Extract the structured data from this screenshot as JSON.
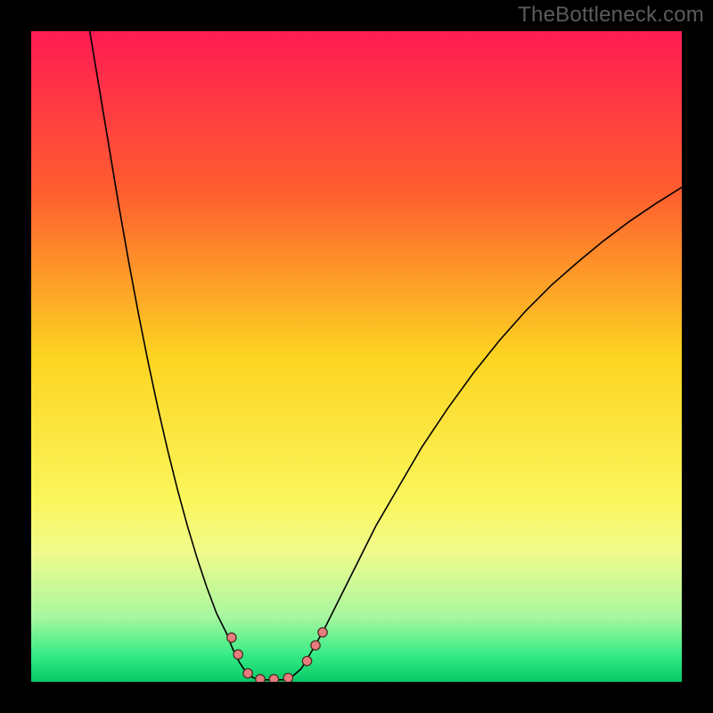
{
  "watermark": "TheBottleneck.com",
  "chart_data": {
    "type": "line",
    "title": "",
    "xlabel": "",
    "ylabel": "",
    "xlim": [
      0,
      100
    ],
    "ylim": [
      0,
      100
    ],
    "gradient_stops": [
      {
        "offset": 0.0,
        "color": "#ff1b54"
      },
      {
        "offset": 0.25,
        "color": "#ff5f2f"
      },
      {
        "offset": 0.5,
        "color": "#fcd421"
      },
      {
        "offset": 0.72,
        "color": "#fbf65c"
      },
      {
        "offset": 0.8,
        "color": "#f0fb8b"
      },
      {
        "offset": 0.9,
        "color": "#a8f7a0"
      },
      {
        "offset": 0.96,
        "color": "#33eb85"
      },
      {
        "offset": 1.0,
        "color": "#07c966"
      }
    ],
    "series": [
      {
        "name": "left-curve",
        "kind": "line",
        "color": "#000000",
        "width": 1.6,
        "points": [
          {
            "x": 9.0,
            "y": 100.0
          },
          {
            "x": 10.5,
            "y": 91.0
          },
          {
            "x": 12.0,
            "y": 82.0
          },
          {
            "x": 13.5,
            "y": 73.0
          },
          {
            "x": 15.0,
            "y": 64.5
          },
          {
            "x": 16.5,
            "y": 56.5
          },
          {
            "x": 18.0,
            "y": 49.0
          },
          {
            "x": 19.5,
            "y": 42.0
          },
          {
            "x": 21.0,
            "y": 35.5
          },
          {
            "x": 22.5,
            "y": 29.5
          },
          {
            "x": 24.0,
            "y": 24.0
          },
          {
            "x": 25.5,
            "y": 19.0
          },
          {
            "x": 27.0,
            "y": 14.5
          },
          {
            "x": 28.5,
            "y": 10.5
          },
          {
            "x": 30.0,
            "y": 7.5
          },
          {
            "x": 31.0,
            "y": 5.0
          },
          {
            "x": 32.0,
            "y": 3.0
          },
          {
            "x": 33.0,
            "y": 1.5
          },
          {
            "x": 34.0,
            "y": 0.7
          },
          {
            "x": 35.0,
            "y": 0.3
          },
          {
            "x": 36.0,
            "y": 0.3
          },
          {
            "x": 37.5,
            "y": 0.3
          },
          {
            "x": 39.0,
            "y": 0.3
          },
          {
            "x": 40.0,
            "y": 0.7
          },
          {
            "x": 41.5,
            "y": 2.0
          },
          {
            "x": 43.0,
            "y": 4.5
          },
          {
            "x": 45.0,
            "y": 8.0
          },
          {
            "x": 47.0,
            "y": 12.0
          },
          {
            "x": 50.0,
            "y": 18.0
          },
          {
            "x": 53.0,
            "y": 24.0
          },
          {
            "x": 56.5,
            "y": 30.0
          },
          {
            "x": 60.0,
            "y": 36.0
          },
          {
            "x": 64.0,
            "y": 42.0
          },
          {
            "x": 68.0,
            "y": 47.5
          },
          {
            "x": 72.0,
            "y": 52.5
          },
          {
            "x": 76.0,
            "y": 57.0
          },
          {
            "x": 80.0,
            "y": 61.0
          },
          {
            "x": 84.0,
            "y": 64.5
          },
          {
            "x": 88.0,
            "y": 67.8
          },
          {
            "x": 92.0,
            "y": 70.8
          },
          {
            "x": 96.0,
            "y": 73.5
          },
          {
            "x": 100.0,
            "y": 76.0
          }
        ]
      },
      {
        "name": "markers",
        "kind": "scatter",
        "color": "#e77c7c",
        "stroke": "#452a22",
        "radius": 5.2,
        "points": [
          {
            "x": 30.8,
            "y": 6.8
          },
          {
            "x": 31.8,
            "y": 4.2
          },
          {
            "x": 33.3,
            "y": 1.3
          },
          {
            "x": 35.2,
            "y": 0.4
          },
          {
            "x": 37.3,
            "y": 0.4
          },
          {
            "x": 39.5,
            "y": 0.6
          },
          {
            "x": 42.4,
            "y": 3.2
          },
          {
            "x": 43.7,
            "y": 5.6
          },
          {
            "x": 44.8,
            "y": 7.6
          }
        ]
      }
    ]
  }
}
